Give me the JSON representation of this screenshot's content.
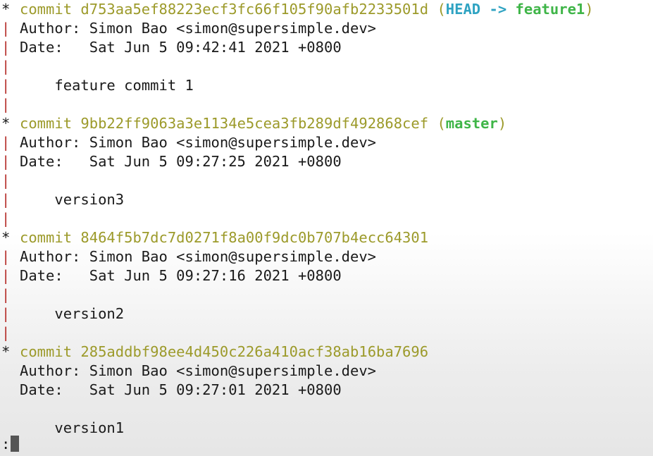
{
  "log": {
    "commits": [
      {
        "keyword": "commit",
        "hash": "d753aa5ef88223ecf3fc66f105f90afb2233501d",
        "refs": {
          "head": "HEAD",
          "arrow": "->",
          "branch": "feature1"
        },
        "author_line": "Author: Simon Bao <simon@supersimple.dev>",
        "date_line": "Date:   Sat Jun 5 09:42:41 2021 +0800",
        "message": "feature commit 1"
      },
      {
        "keyword": "commit",
        "hash": "9bb22ff9063a3e1134e5cea3fb289df492868cef",
        "refs": {
          "branch": "master"
        },
        "author_line": "Author: Simon Bao <simon@supersimple.dev>",
        "date_line": "Date:   Sat Jun 5 09:27:25 2021 +0800",
        "message": "version3"
      },
      {
        "keyword": "commit",
        "hash": "8464f5b7dc7d0271f8a00f9dc0b707b4ecc64301",
        "author_line": "Author: Simon Bao <simon@supersimple.dev>",
        "date_line": "Date:   Sat Jun 5 09:27:16 2021 +0800",
        "message": "version2"
      },
      {
        "keyword": "commit",
        "hash": "285addbf98ee4d450c226a410acf38ab16ba7696",
        "author_line": "Author: Simon Bao <simon@supersimple.dev>",
        "date_line": "Date:   Sat Jun 5 09:27:01 2021 +0800",
        "message": "version1"
      }
    ],
    "graph": {
      "node": "*",
      "edge": "|"
    },
    "prompt": ":"
  },
  "colors": {
    "commit_hash": "#9c9a2a",
    "head_ref": "#2fa3c2",
    "branch_ref": "#3fb548",
    "graph_edge": "#b7332f"
  }
}
